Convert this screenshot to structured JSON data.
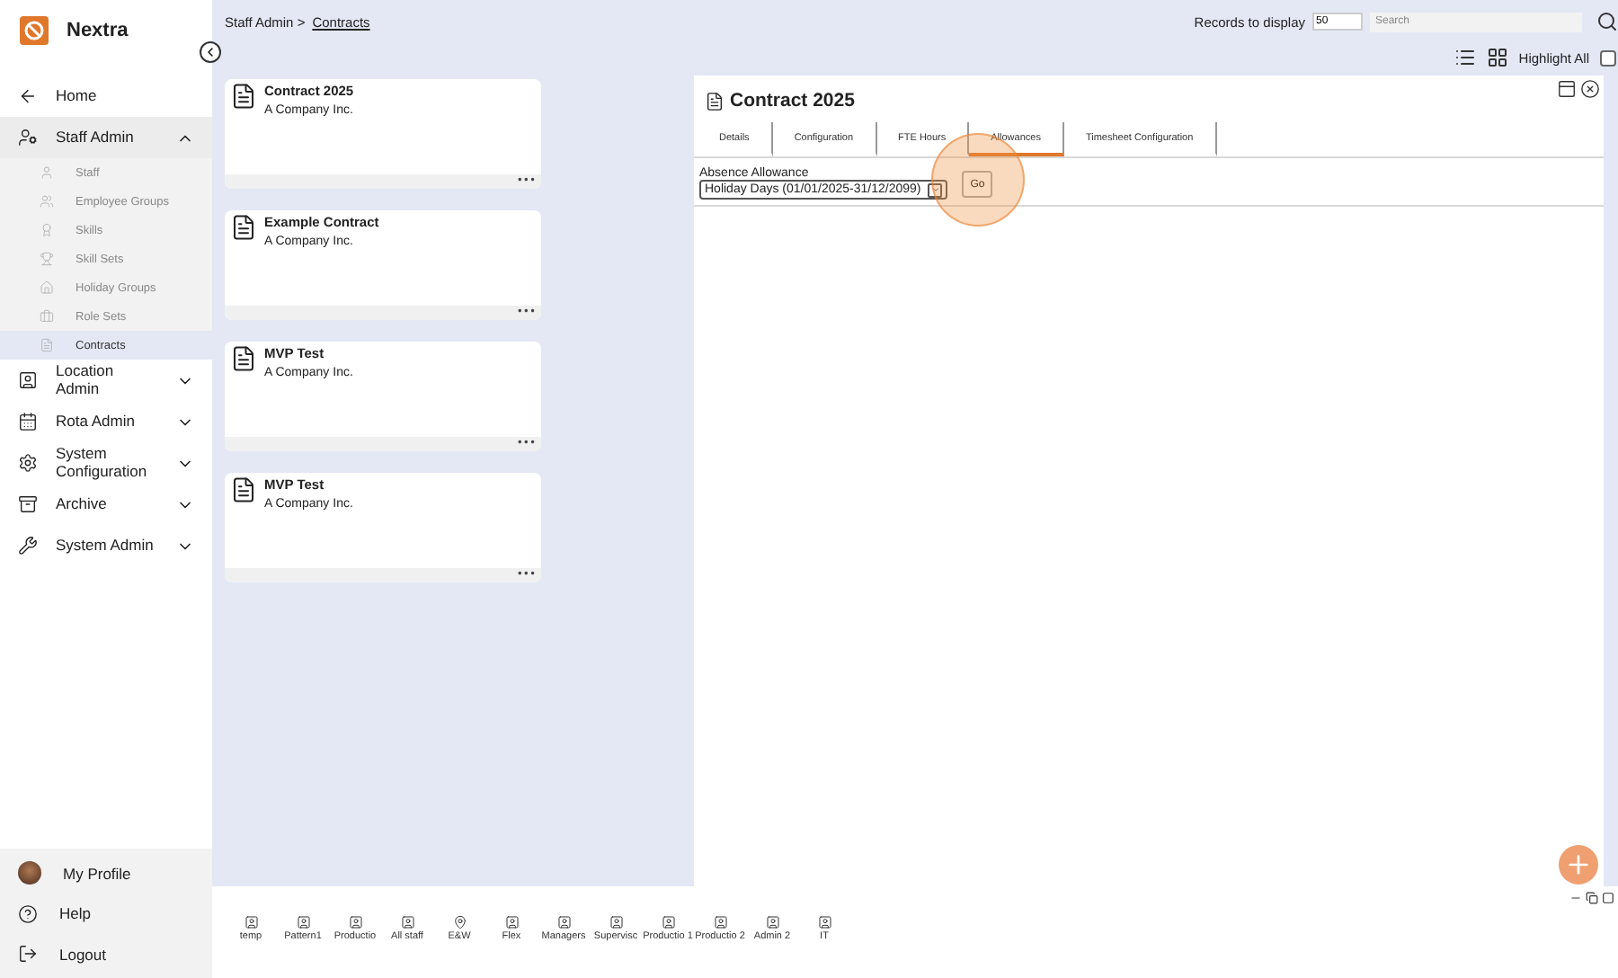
{
  "brand": {
    "name": "Nextra"
  },
  "sidebar": {
    "items": [
      {
        "label": "Home"
      },
      {
        "label": "Staff Admin",
        "expanded": true,
        "children": [
          {
            "label": "Staff",
            "selected": false
          },
          {
            "label": "Employee Groups",
            "selected": false
          },
          {
            "label": "Skills",
            "selected": false
          },
          {
            "label": "Skill Sets",
            "selected": false
          },
          {
            "label": "Holiday Groups",
            "selected": false
          },
          {
            "label": "Role Sets",
            "selected": false
          },
          {
            "label": "Contracts",
            "selected": true
          }
        ]
      },
      {
        "label": "Location Admin",
        "expanded": false
      },
      {
        "label": "Rota Admin",
        "expanded": false
      },
      {
        "label": "System Configuration",
        "expanded": false
      },
      {
        "label": "Archive",
        "expanded": false
      },
      {
        "label": "System Admin",
        "expanded": false
      }
    ],
    "footer": [
      {
        "label": "My Profile"
      },
      {
        "label": "Help"
      },
      {
        "label": "Logout"
      }
    ]
  },
  "breadcrumb": {
    "parent": "Staff Admin",
    "separator": ">",
    "current": "Contracts"
  },
  "toolbar": {
    "records_label": "Records to display",
    "records_value": "50",
    "search_placeholder": "Search",
    "highlight_label": "Highlight All",
    "highlight_checked": false
  },
  "cards": [
    {
      "title": "Contract 2025",
      "subtitle": "A Company Inc.",
      "menu": "•••"
    },
    {
      "title": "Example Contract",
      "subtitle": "A Company Inc.",
      "menu": "•••"
    },
    {
      "title": "MVP Test",
      "subtitle": "A Company Inc.",
      "menu": "•••"
    },
    {
      "title": "MVP Test",
      "subtitle": "A Company Inc.",
      "menu": "•••"
    }
  ],
  "detail": {
    "title": "Contract 2025",
    "tabs": [
      {
        "label": "Details",
        "selected": false
      },
      {
        "label": "Configuration",
        "selected": false
      },
      {
        "label": "FTE Hours",
        "selected": false
      },
      {
        "label": "Allowances",
        "selected": true
      },
      {
        "label": "Timesheet Configuration",
        "selected": false
      }
    ],
    "field_label": "Absence Allowance",
    "select_value": "Holiday Days (01/01/2025-31/12/2099)",
    "go_button": "Go"
  },
  "shortcuts": [
    {
      "label": "temp",
      "kind": "person"
    },
    {
      "label": "Pattern1",
      "kind": "person"
    },
    {
      "label": "Productio",
      "kind": "person"
    },
    {
      "label": "All staff",
      "kind": "person"
    },
    {
      "label": "E&W",
      "kind": "location"
    },
    {
      "label": "Flex",
      "kind": "person"
    },
    {
      "label": "Managers",
      "kind": "person"
    },
    {
      "label": "Supervisc",
      "kind": "person"
    },
    {
      "label": "Productio 1",
      "kind": "person"
    },
    {
      "label": "Productio 2",
      "kind": "person"
    },
    {
      "label": "Admin 2",
      "kind": "person"
    },
    {
      "label": "IT",
      "kind": "person"
    }
  ]
}
